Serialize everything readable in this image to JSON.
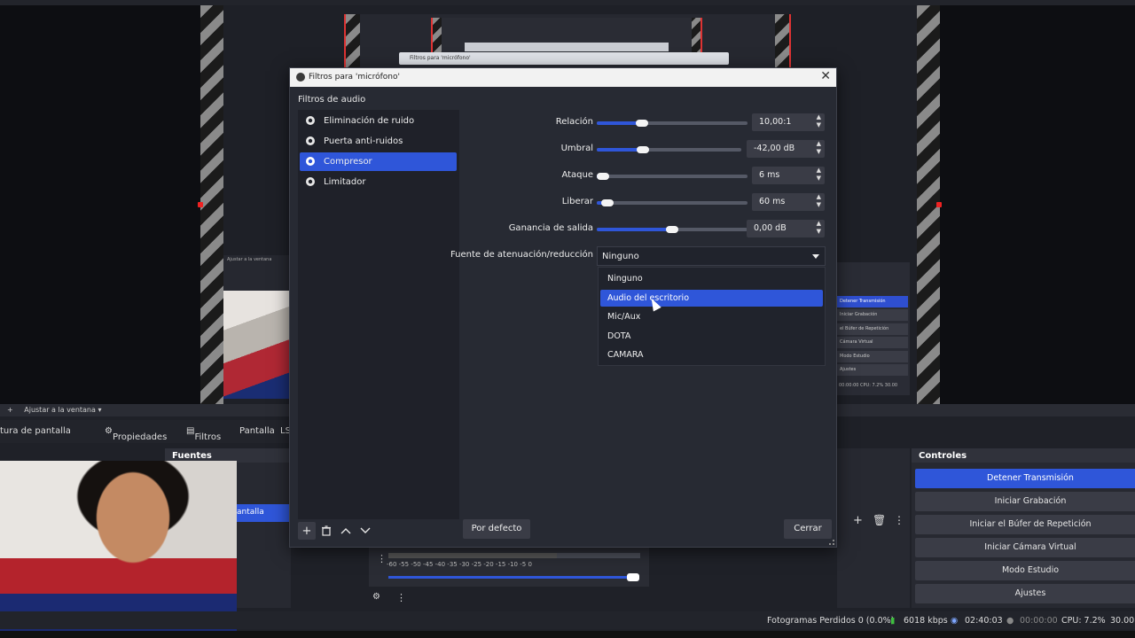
{
  "dialog": {
    "title": "Filtros para 'micrófono'",
    "section_label": "Filtros de audio",
    "filters": [
      {
        "label": "Eliminación de ruido",
        "selected": false
      },
      {
        "label": "Puerta anti-ruidos",
        "selected": false
      },
      {
        "label": "Compresor",
        "selected": true
      },
      {
        "label": "Limitador",
        "selected": false
      }
    ],
    "properties": {
      "ratio": {
        "label": "Relación",
        "value": "10,00:1",
        "level": 0.3
      },
      "threshold": {
        "label": "Umbral",
        "value": "-42,00 dB",
        "level": 0.32
      },
      "attack": {
        "label": "Ataque",
        "value": "6 ms",
        "level": 0.01
      },
      "release": {
        "label": "Liberar",
        "value": "60 ms",
        "level": 0.07
      },
      "output_gain": {
        "label": "Ganancia de salida",
        "value": "0,00 dB",
        "level": 0.5
      },
      "sidechain": {
        "label": "Fuente de atenuación/reducción",
        "value": "Ninguno"
      }
    },
    "dropdown_options": [
      "Ninguno",
      "Audio del escritorio",
      "Mic/Aux",
      "DOTA",
      "CAMARA"
    ],
    "highlighted_option": "Audio del escritorio",
    "defaults_button": "Por defecto",
    "close_button": "Cerrar"
  },
  "background": {
    "mini_dialog_title": "Filtros para 'micrófono'",
    "fit_window": "Ajustar a la ventana",
    "tabs": [
      "tura de pantalla",
      "Propiedades",
      "Filtros",
      "Pantalla",
      "LS"
    ],
    "sources_header": "Fuentes",
    "source_item": "antalla",
    "controls_header": "Controles",
    "controls": [
      "Detener Transmisión",
      "Iniciar Grabación",
      "Iniciar el Búfer de Repetición",
      "Iniciar Cámara Virtual",
      "Modo Estudio",
      "Ajustes"
    ],
    "mini_controls": [
      "Detener Transmisión",
      "Iniciar Grabación",
      "el Búfer de Repetición",
      "Cámara Virtual",
      "Modo Estudio",
      "Ajustes"
    ],
    "mixer_scale": "-60 -55 -50 -45 -40 -35 -30 -25 -20 -15 -10 -5 0",
    "status": {
      "dropped_frames": "Fotogramas Perdidos 0 (0.0%)",
      "bitrate": "6018 kbps",
      "stream_time": "02:40:03",
      "rec_time": "00:00:00",
      "cpu": "CPU: 7.2%",
      "fps": "30.00"
    },
    "mini_status": "00:00:00   CPU: 7.2%   30.00"
  }
}
